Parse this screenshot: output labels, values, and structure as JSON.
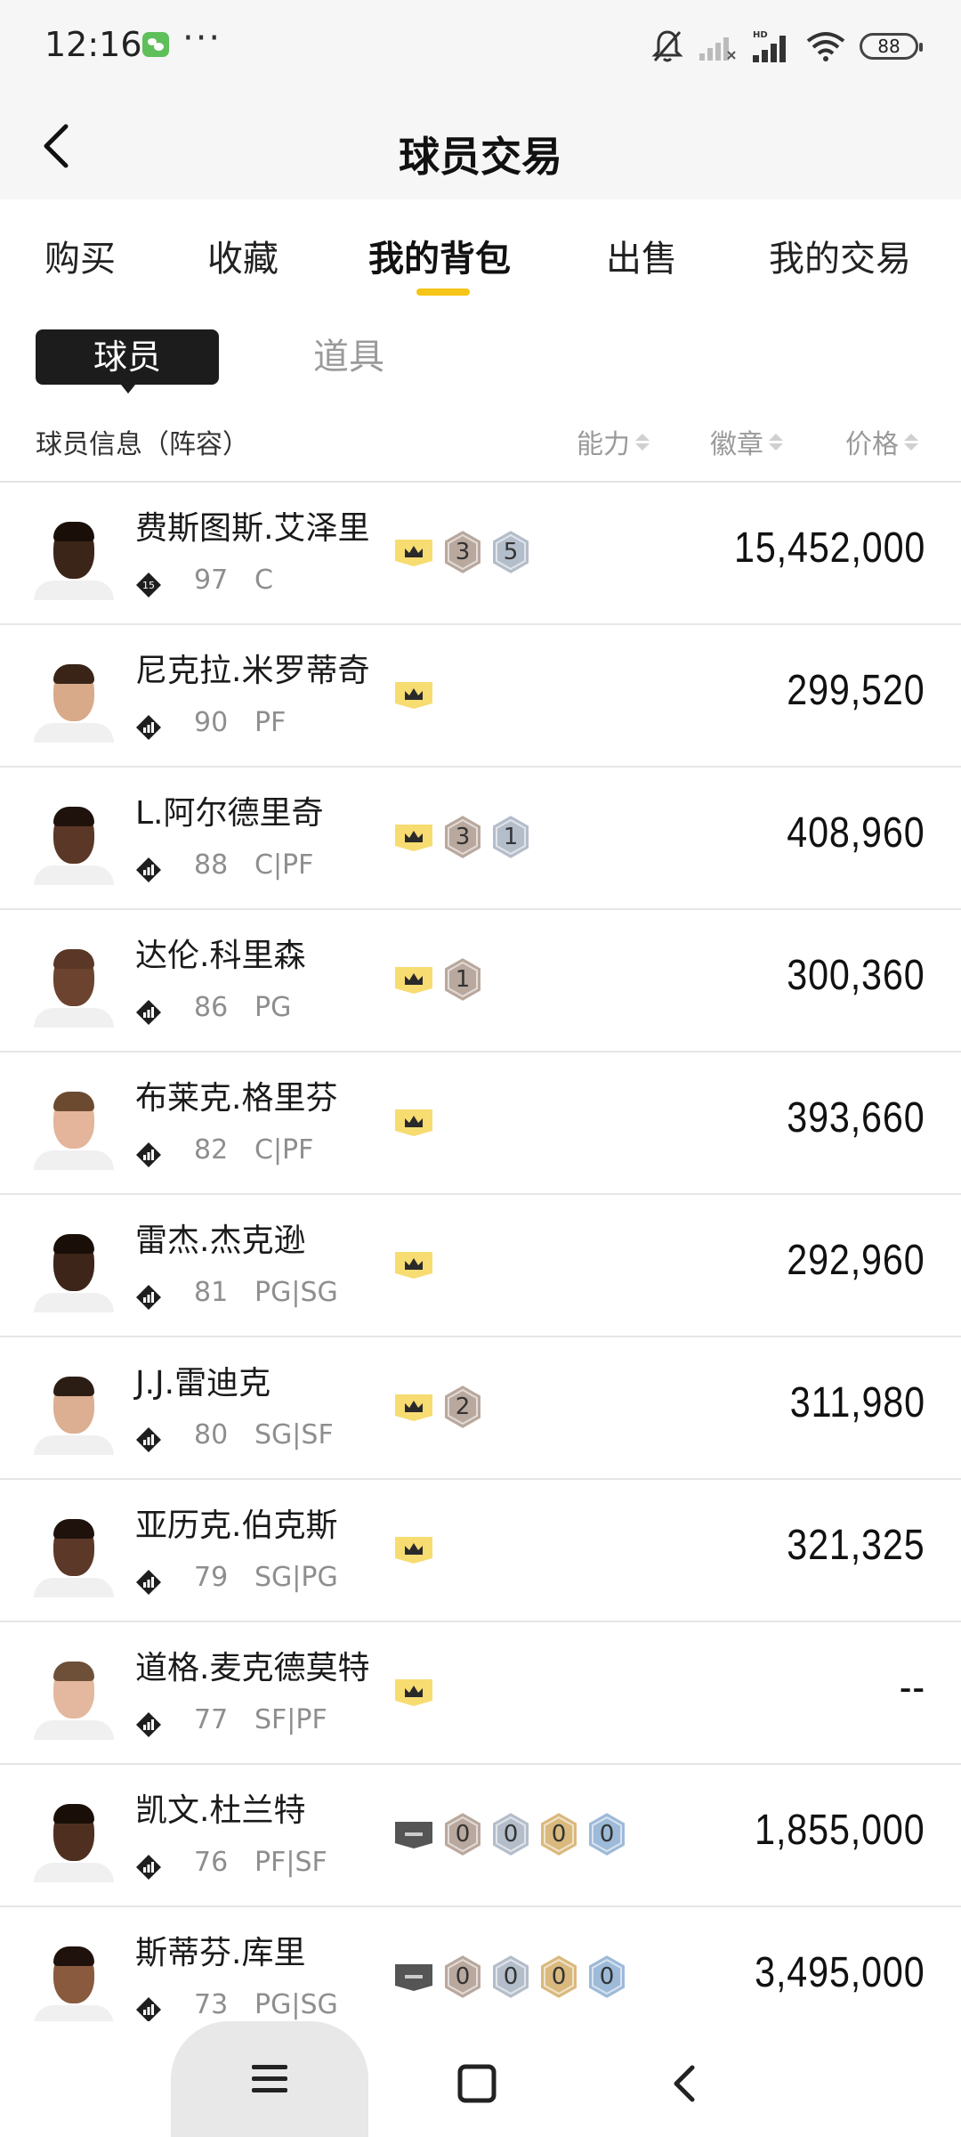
{
  "status_bar": {
    "time": "12:16",
    "dots": "···",
    "battery": "88",
    "icons": [
      "wechat-icon",
      "bell-muted-icon",
      "signal-icon",
      "hd-signal-icon",
      "wifi-icon",
      "battery-icon"
    ]
  },
  "header": {
    "title": "球员交易"
  },
  "tabs": [
    {
      "label": "购买",
      "active": false
    },
    {
      "label": "收藏",
      "active": false
    },
    {
      "label": "我的背包",
      "active": true
    },
    {
      "label": "出售",
      "active": false
    },
    {
      "label": "我的交易",
      "active": false
    }
  ],
  "segments": {
    "active": "球员",
    "inactive": "道具"
  },
  "columns": {
    "info": "球员信息（阵容）",
    "ability": "能力",
    "badge": "徽章",
    "price": "价格"
  },
  "colors": {
    "accent": "#f5c518",
    "crown_bg": "#f7dc72",
    "bronze": "#b9a89d",
    "silver": "#b4bdca",
    "gold": "#d9b97d",
    "blue": "#9dbad8"
  },
  "players": [
    {
      "name": "费斯图斯.艾泽里",
      "rating": "97",
      "position": "C",
      "rank_badge": "15",
      "badges": [
        {
          "type": "crown"
        },
        {
          "type": "medal",
          "tier": "bronze",
          "value": "3"
        },
        {
          "type": "medal",
          "tier": "silver",
          "value": "5"
        }
      ],
      "price": "15,452,000",
      "skin": "#3b2418",
      "hair": "#1a0f08"
    },
    {
      "name": "尼克拉.米罗蒂奇",
      "rating": "90",
      "position": "PF",
      "badges": [
        {
          "type": "crown"
        }
      ],
      "price": "299,520",
      "skin": "#d9aa8a",
      "hair": "#3a2418"
    },
    {
      "name": "L.阿尔德里奇",
      "rating": "88",
      "position": "C|PF",
      "badges": [
        {
          "type": "crown"
        },
        {
          "type": "medal",
          "tier": "bronze",
          "value": "3"
        },
        {
          "type": "medal",
          "tier": "silver",
          "value": "1"
        }
      ],
      "price": "408,960",
      "skin": "#5a3726",
      "hair": "#1f120c"
    },
    {
      "name": "达伦.科里森",
      "rating": "86",
      "position": "PG",
      "badges": [
        {
          "type": "crown"
        },
        {
          "type": "medal",
          "tier": "bronze",
          "value": "1"
        }
      ],
      "price": "300,360",
      "skin": "#6b432e",
      "hair": "#5a3726"
    },
    {
      "name": "布莱克.格里芬",
      "rating": "82",
      "position": "C|PF",
      "badges": [
        {
          "type": "crown"
        }
      ],
      "price": "393,660",
      "skin": "#e4b59a",
      "hair": "#6b4a30"
    },
    {
      "name": "雷杰.杰克逊",
      "rating": "81",
      "position": "PG|SG",
      "badges": [
        {
          "type": "crown"
        }
      ],
      "price": "292,960",
      "skin": "#3e2519",
      "hair": "#1a0f08"
    },
    {
      "name": "J.J.雷迪克",
      "rating": "80",
      "position": "SG|SF",
      "badges": [
        {
          "type": "crown"
        },
        {
          "type": "medal",
          "tier": "bronze",
          "value": "2"
        }
      ],
      "price": "311,980",
      "skin": "#dcae92",
      "hair": "#2c1d14"
    },
    {
      "name": "亚历克.伯克斯",
      "rating": "79",
      "position": "SG|PG",
      "badges": [
        {
          "type": "crown"
        }
      ],
      "price": "321,325",
      "skin": "#5c3828",
      "hair": "#1f120c"
    },
    {
      "name": "道格.麦克德莫特",
      "rating": "77",
      "position": "SF|PF",
      "badges": [
        {
          "type": "crown"
        }
      ],
      "price": "--",
      "skin": "#e3b89e",
      "hair": "#6e4f38"
    },
    {
      "name": "凯文.杜兰特",
      "rating": "76",
      "position": "PF|SF",
      "badges": [
        {
          "type": "shield"
        },
        {
          "type": "medal",
          "tier": "bronze",
          "value": "0"
        },
        {
          "type": "medal",
          "tier": "silver",
          "value": "0"
        },
        {
          "type": "medal",
          "tier": "gold",
          "value": "0"
        },
        {
          "type": "medal",
          "tier": "blue",
          "value": "0"
        }
      ],
      "price": "1,855,000",
      "skin": "#4f3020",
      "hair": "#1a0f08"
    },
    {
      "name": "斯蒂芬.库里",
      "rating": "73",
      "position": "PG|SG",
      "badges": [
        {
          "type": "shield"
        },
        {
          "type": "medal",
          "tier": "bronze",
          "value": "0"
        },
        {
          "type": "medal",
          "tier": "silver",
          "value": "0"
        },
        {
          "type": "medal",
          "tier": "gold",
          "value": "0"
        },
        {
          "type": "medal",
          "tier": "blue",
          "value": "0"
        }
      ],
      "price": "3,495,000",
      "skin": "#8a5a3e",
      "hair": "#1f120c"
    }
  ],
  "nav": {
    "icons": [
      "menu-icon",
      "home-square-icon",
      "back-chevron-icon"
    ]
  }
}
